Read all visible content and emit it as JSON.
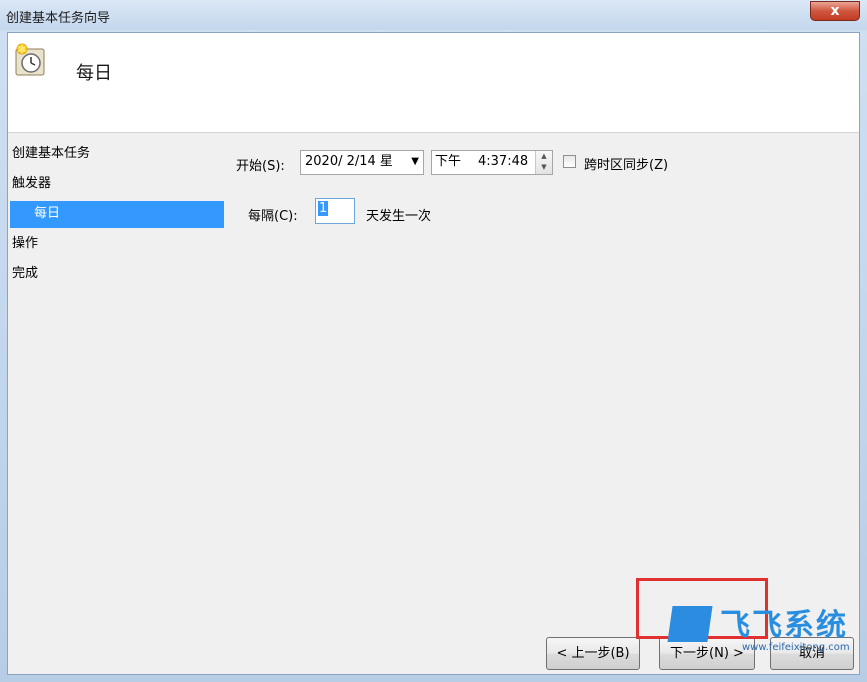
{
  "window": {
    "title": "创建基本任务向导",
    "close_label": "x"
  },
  "header": {
    "title": "每日"
  },
  "steps": [
    {
      "label": "创建基本任务"
    },
    {
      "label": "触发器"
    },
    {
      "label": "每日"
    },
    {
      "label": "操作"
    },
    {
      "label": "完成"
    }
  ],
  "form": {
    "start_label": "开始(S):",
    "start_date": "2020/  2/14 星",
    "start_time_ampm": "下午",
    "start_time": "4:37:48",
    "sync_label": "跨时区同步(Z)",
    "interval_label": "每隔(C):",
    "interval_value": "1",
    "interval_suffix": "天发生一次"
  },
  "buttons": {
    "back": "< 上一步(B)",
    "next": "下一步(N) >",
    "cancel": "取消"
  },
  "watermark": {
    "text": "飞飞系统",
    "url": "www.feifeixitong.com"
  },
  "colors": {
    "selection": "#3399ff",
    "highlight_box": "#e03030"
  },
  "icons": [
    "scheduled-task-clock-icon",
    "dropdown-arrow-icon",
    "spin-up-icon",
    "spin-down-icon",
    "checkbox-icon",
    "close-icon"
  ]
}
